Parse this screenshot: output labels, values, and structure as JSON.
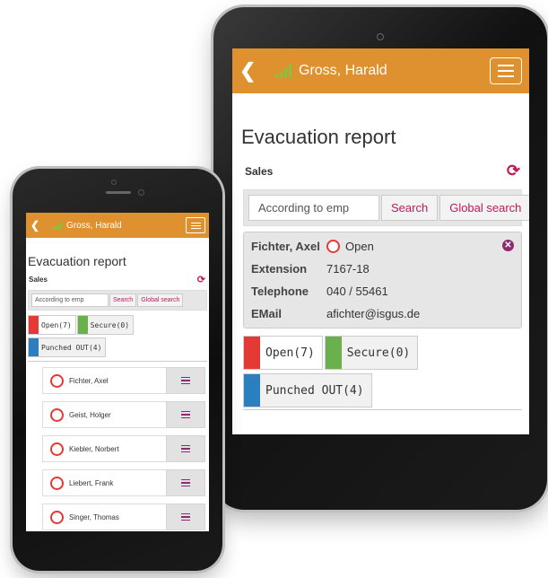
{
  "colors": {
    "header": "#e0912f",
    "accent": "#c2185b",
    "open": "#e53935",
    "secure": "#6ab04c",
    "punched_out": "#2a7fc1",
    "signal": "#7ec540"
  },
  "header": {
    "user": "Gross, Harald",
    "back_icon": "chevron-left-icon",
    "signal_icon": "signal-strength-icon",
    "menu_icon": "hamburger-menu-icon"
  },
  "page": {
    "title": "Evacuation report",
    "department": "Sales"
  },
  "search": {
    "placeholder": "According to emp",
    "search_label": "Search",
    "global_label": "Global search"
  },
  "detail": {
    "name": "Fichter, Axel",
    "status": "Open",
    "fields": [
      {
        "label": "Extension",
        "value": "7167-18"
      },
      {
        "label": "Telephone",
        "value": "040 / 55461"
      },
      {
        "label": "EMail",
        "value": "afichter@isgus.de"
      }
    ]
  },
  "tabs": [
    {
      "label": "Open(7)",
      "color": "#e53935"
    },
    {
      "label": "Secure(0)",
      "color": "#6ab04c"
    },
    {
      "label": "Punched OUT(4)",
      "color": "#2a7fc1"
    }
  ],
  "employees": [
    {
      "name": "Fichter, Axel"
    },
    {
      "name": "Geist, Holger"
    },
    {
      "name": "Kiebler, Norbert"
    },
    {
      "name": "Liebert, Frank"
    },
    {
      "name": "Singer, Thomas"
    }
  ]
}
